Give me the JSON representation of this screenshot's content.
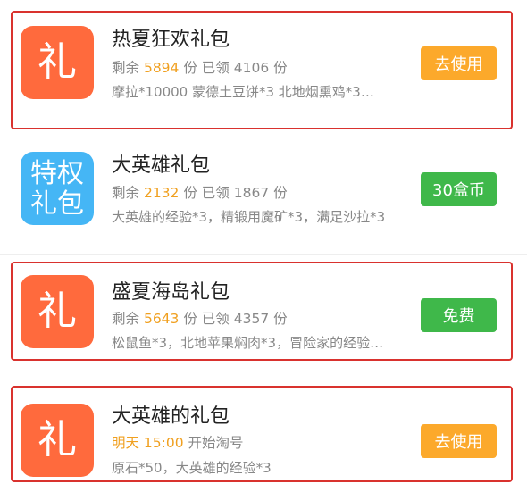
{
  "gifts": [
    {
      "icon_text": "礼",
      "icon_color": "#ff6a3d",
      "title": "热夏狂欢礼包",
      "remaining_label": "剩余",
      "remaining": "5894",
      "unit": "份",
      "claimed_label": "已领",
      "claimed": "4106",
      "contents": "摩拉*10000 蒙德土豆饼*3 北地烟熏鸡*3…",
      "button": "去使用",
      "button_color": "#fca92b"
    },
    {
      "icon_text": "特权\n礼包",
      "icon_color": "#45b6f5",
      "title": "大英雄礼包",
      "remaining_label": "剩余",
      "remaining": "2132",
      "unit": "份",
      "claimed_label": "已领",
      "claimed": "1867",
      "contents": "大英雄的经验*3，精锻用魔矿*3，满足沙拉*3",
      "button": "30盒币",
      "button_color": "#3fb84a"
    },
    {
      "icon_text": "礼",
      "icon_color": "#ff6a3d",
      "title": "盛夏海岛礼包",
      "remaining_label": "剩余",
      "remaining": "5643",
      "unit": "份",
      "claimed_label": "已领",
      "claimed": "4357",
      "contents": "松鼠鱼*3，北地苹果焖肉*3，冒险家的经验…",
      "button": "免费",
      "button_color": "#3fb84a"
    },
    {
      "icon_text": "礼",
      "icon_color": "#ff6a3d",
      "title": "大英雄的礼包",
      "time_highlight": "明天 15:00",
      "time_suffix": "开始淘号",
      "contents": "原石*50，大英雄的经验*3",
      "button": "去使用",
      "button_color": "#fca92b"
    }
  ]
}
